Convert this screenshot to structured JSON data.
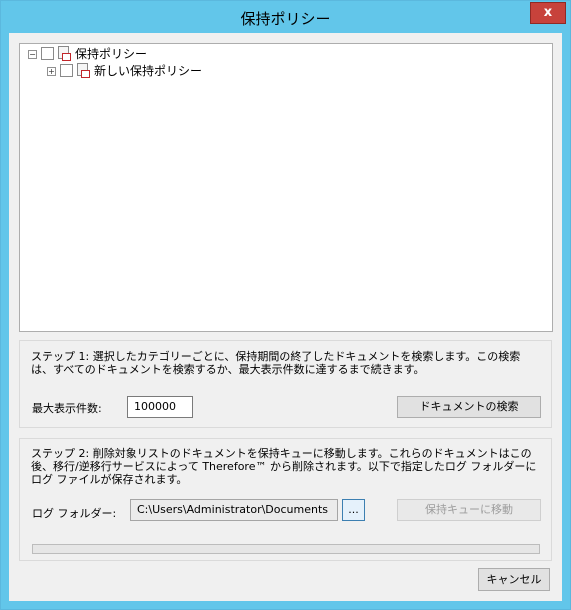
{
  "window": {
    "title": "保持ポリシー",
    "close_label": "x"
  },
  "tree": {
    "root": {
      "label": "保持ポリシー",
      "expander": "−"
    },
    "child": {
      "label": "新しい保持ポリシー",
      "expander": "+"
    }
  },
  "step1": {
    "text": "ステップ 1: 選択したカテゴリーごとに、保持期間の終了したドキュメントを検索します。この検索は、すべてのドキュメントを検索するか、最大表示件数に達するまで続きます。",
    "max_label": "最大表示件数:",
    "max_value": "100000",
    "search_button": "ドキュメントの検索"
  },
  "step2": {
    "text": "ステップ 2: 削除対象リストのドキュメントを保持キューに移動します。これらのドキュメントはこの後、移行/逆移行サービスによって Therefore™ から削除されます。以下で指定したログ フォルダーにログ ファイルが保存されます。",
    "log_label": "ログ フォルダー:",
    "log_value": "C:\\Users\\Administrator\\Documents",
    "browse_button": "...",
    "move_button": "保持キューに移動",
    "progress": 0
  },
  "footer": {
    "cancel_button": "キャンセル"
  }
}
